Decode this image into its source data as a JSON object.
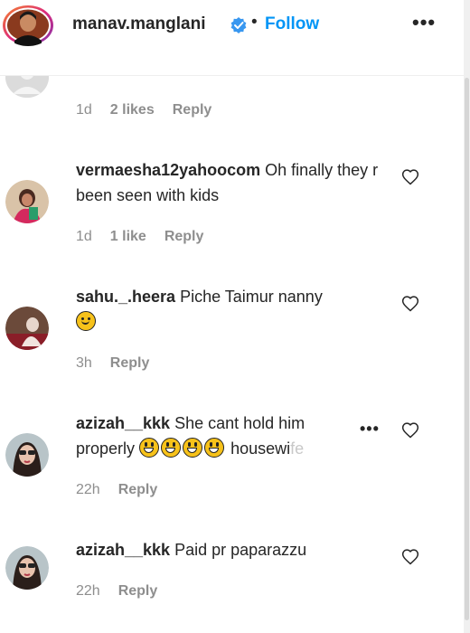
{
  "header": {
    "username": "manav.manglani",
    "separator": "•",
    "follow_label": "Follow",
    "more_label": "•••",
    "verified_icon": "verified-badge-icon",
    "accent_color": "#0095f6"
  },
  "first_meta": {
    "time": "1d",
    "likes": "2 likes",
    "reply": "Reply"
  },
  "comments": [
    {
      "username": "vermaesha12yahoocom",
      "text": " Oh finally they r been seen with kids",
      "time": "1d",
      "likes": "1 like",
      "reply": "Reply"
    },
    {
      "username": "sahu._.heera",
      "text": " Piche Taimur nanny",
      "emoji": "smiling-face-emoji",
      "time": "3h",
      "reply": "Reply"
    },
    {
      "username": "azizah__kkk",
      "text_a": " She cant hold him",
      "text_b": "properly",
      "text_c": "housewi",
      "text_fade": "fe",
      "more_label": "•••",
      "time": "22h",
      "reply": "Reply"
    },
    {
      "username": "azizah__kkk",
      "text": " Paid pr paparazzu",
      "time": "22h",
      "reply": "Reply"
    }
  ]
}
